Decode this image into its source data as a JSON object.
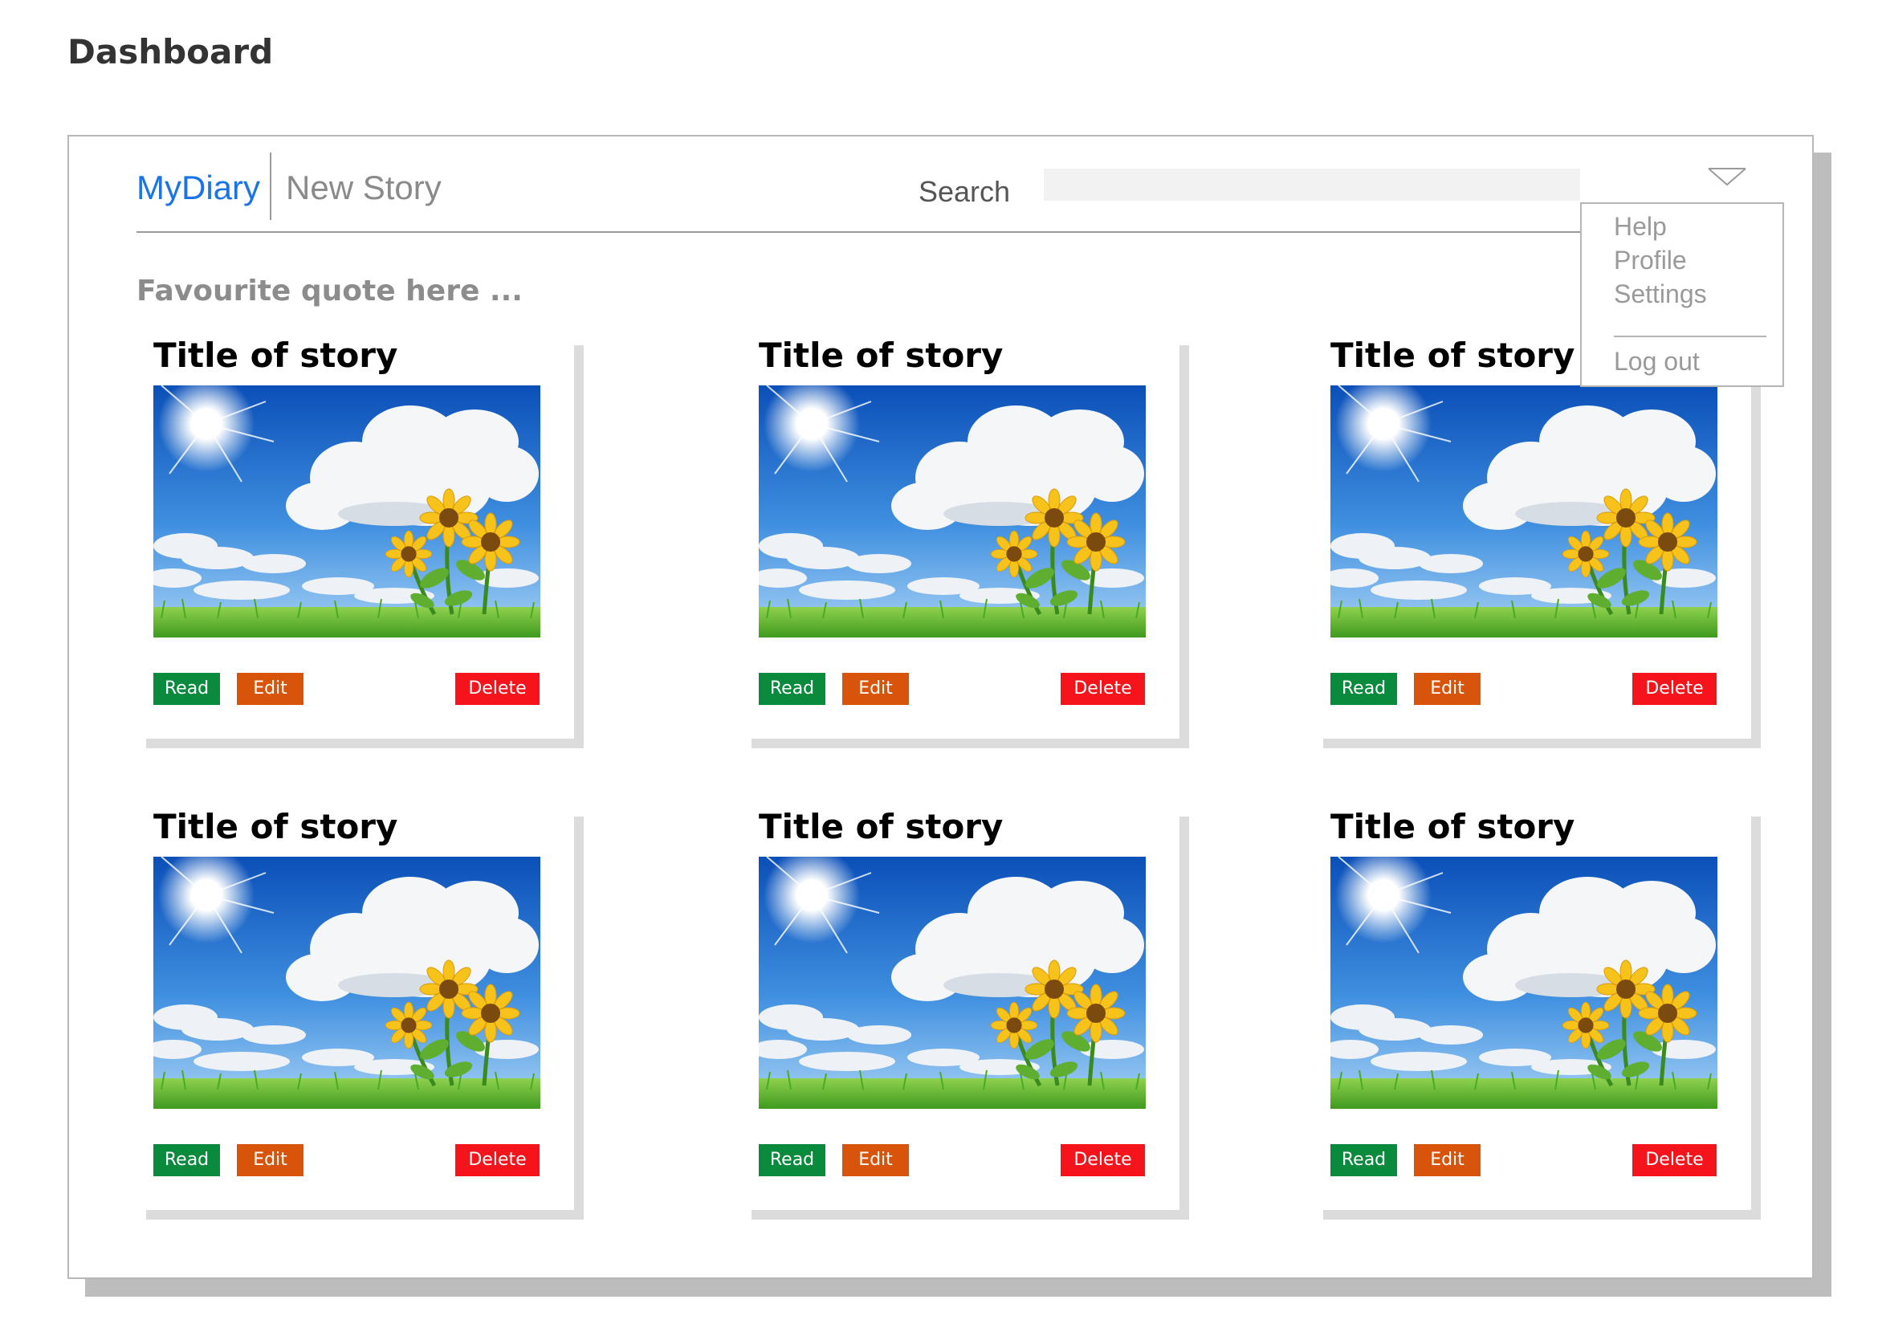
{
  "page": {
    "title": "Dashboard"
  },
  "nav": {
    "brand": "MyDiary",
    "new_story": "New Story",
    "search_label": "Search",
    "search_value": "",
    "brand_color": "#1a73e8"
  },
  "menu": {
    "items": [
      "Help",
      "Profile",
      "Settings"
    ],
    "logout": "Log out"
  },
  "quote": "Favourite quote here ...",
  "stories": [
    {
      "title": "Title of story",
      "read": "Read",
      "edit": "Edit",
      "delete": "Delete"
    },
    {
      "title": "Title of story",
      "read": "Read",
      "edit": "Edit",
      "delete": "Delete"
    },
    {
      "title": "Title of story",
      "read": "Read",
      "edit": "Edit",
      "delete": "Delete"
    },
    {
      "title": "Title of story",
      "read": "Read",
      "edit": "Edit",
      "delete": "Delete"
    },
    {
      "title": "Title of story",
      "read": "Read",
      "edit": "Edit",
      "delete": "Delete"
    },
    {
      "title": "Title of story",
      "read": "Read",
      "edit": "Edit",
      "delete": "Delete"
    }
  ],
  "colors": {
    "read": "#0a8a3c",
    "edit": "#d9540b",
    "delete": "#f5141c"
  }
}
